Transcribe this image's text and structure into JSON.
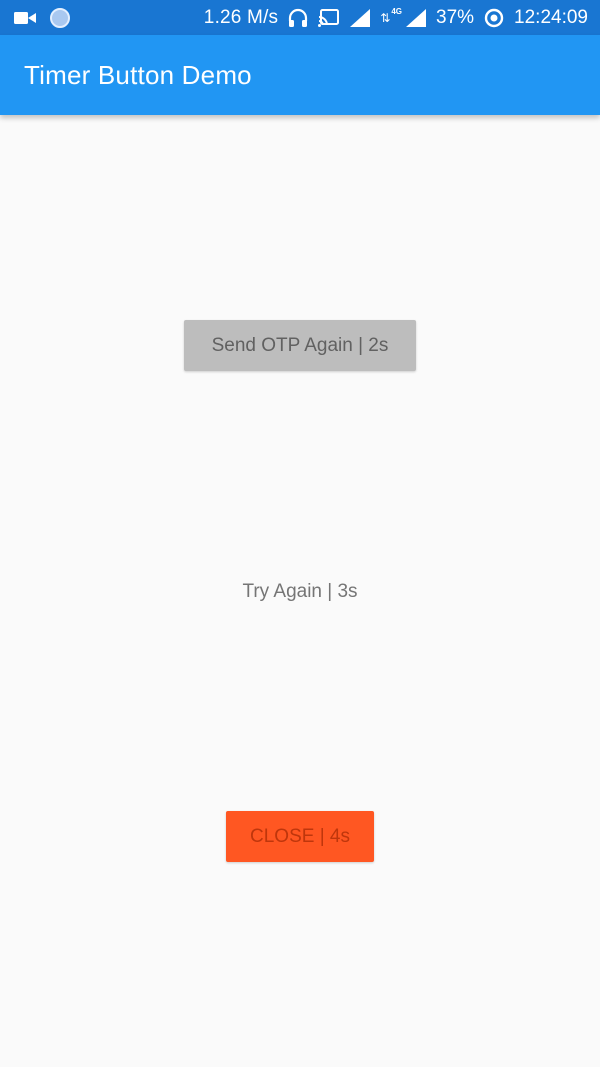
{
  "status_bar": {
    "network_speed": "1.26 M/s",
    "network_type": "4G",
    "battery": "37%",
    "time": "12:24:09",
    "icons": [
      "video-camera-icon",
      "circle-notification-icon",
      "headphones-icon",
      "cast-icon",
      "signal-icon",
      "data-arrows-icon",
      "battery-saver-icon"
    ]
  },
  "app_bar": {
    "title": "Timer Button Demo",
    "color": "#2196f3"
  },
  "buttons": {
    "send_otp": {
      "label": "Send OTP Again |  2s",
      "color": "#bdbdbd"
    },
    "try_again": {
      "label": "Try Again |  3s"
    },
    "close": {
      "label": "CLOSE |  4s",
      "color": "#ff5722"
    }
  }
}
